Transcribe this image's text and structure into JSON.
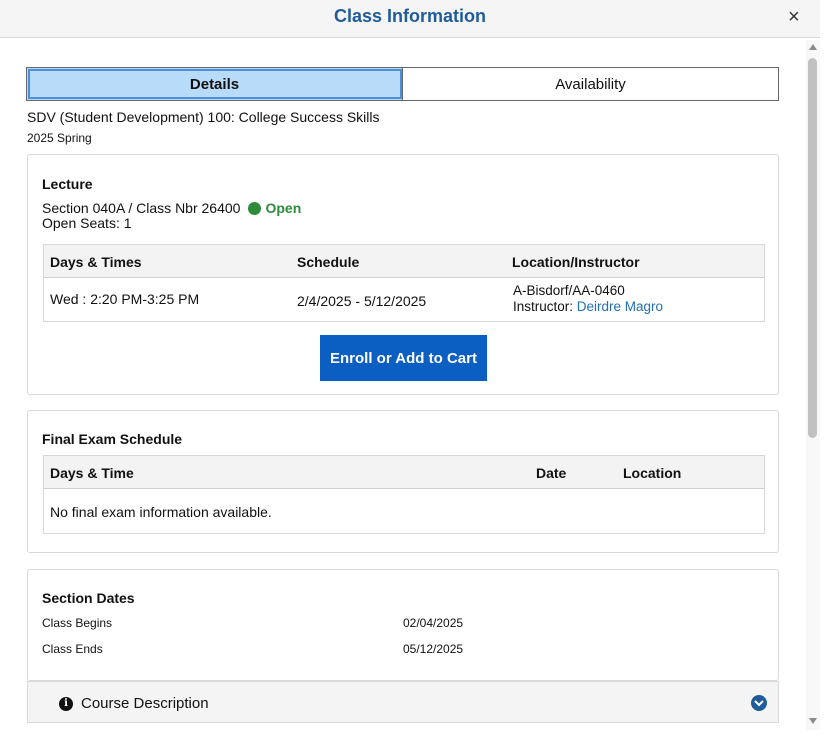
{
  "window": {
    "title": "Class Information",
    "close_label": "×"
  },
  "tabs": [
    {
      "label": "Details",
      "active": true
    },
    {
      "label": "Availability",
      "active": false
    }
  ],
  "course": {
    "title": "SDV (Student Development) 100: College Success Skills",
    "term": "2025 Spring"
  },
  "lecture": {
    "heading": "Lecture",
    "section": "Section 040A / Class Nbr 26400",
    "status": "Open",
    "status_color": "#2e8b3a",
    "open_seats": "Open Seats: 1",
    "columns": [
      "Days & Times",
      "Schedule",
      "Location/Instructor"
    ],
    "row": {
      "days_times": "Wed : 2:20 PM-3:25 PM",
      "schedule": "2/4/2025 - 5/12/2025",
      "location": "A-Bisdorf/AA-0460",
      "instructor_prefix": "Instructor: ",
      "instructor_name": "Deirdre Magro"
    },
    "enroll_button": "Enroll or Add to Cart"
  },
  "final_exam": {
    "heading": "Final Exam Schedule",
    "columns": [
      "Days & Time",
      "Date",
      "Location"
    ],
    "empty_message": "No final exam information available."
  },
  "section_dates": {
    "heading": "Section Dates",
    "rows": [
      {
        "label": "Class Begins",
        "value": "02/04/2025"
      },
      {
        "label": "Class Ends",
        "value": "05/12/2025"
      }
    ]
  },
  "accordion": {
    "label": "Course Description",
    "icon": "info-icon",
    "toggle_icon": "chevron-down-icon"
  },
  "colors": {
    "accent": "#1f5c99",
    "button": "#0b5fc2",
    "link": "#1f6fb2",
    "tab_active": "#b9dbfa"
  }
}
